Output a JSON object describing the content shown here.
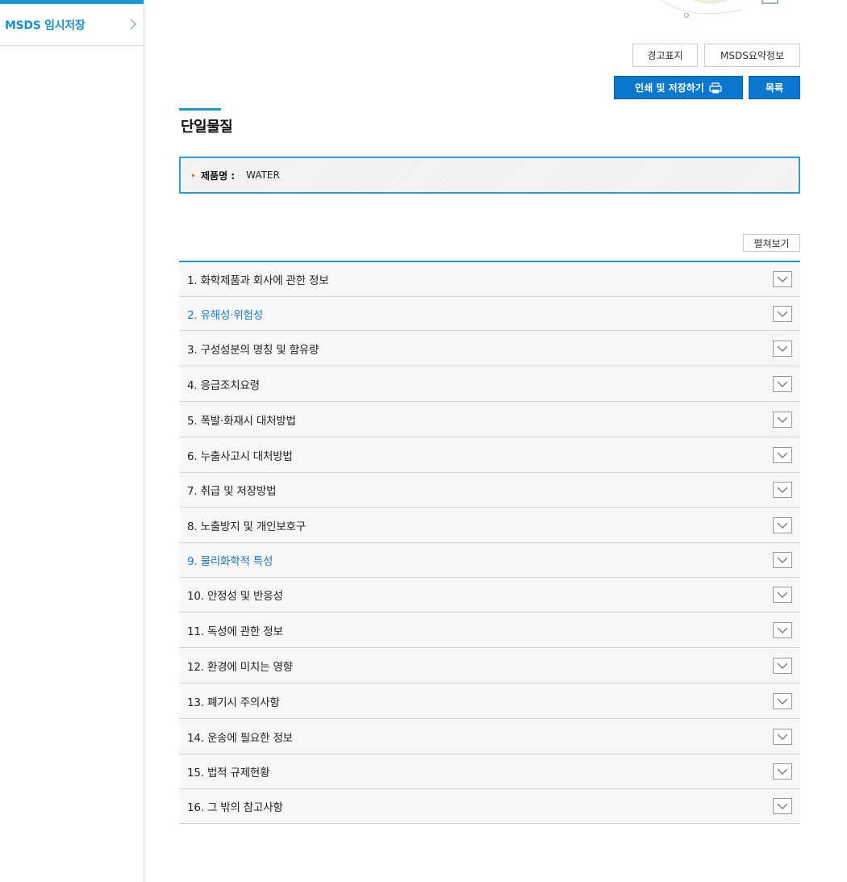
{
  "sidebar": {
    "item_label": "MSDS 임시저장"
  },
  "toolbar": {
    "warning_label": "경고표지",
    "msds_summary": "MSDS요약정보",
    "print_save": "인쇄 및 저장하기",
    "list": "목록"
  },
  "page": {
    "title": "단일물질"
  },
  "product": {
    "label": "제품명 :",
    "value": "WATER"
  },
  "expand_all": "펼쳐보기",
  "sections": [
    {
      "label": "1. 화학제품과 회사에 관한 정보",
      "highlight": false
    },
    {
      "label": "2. 유해성·위험성",
      "highlight": true
    },
    {
      "label": "3. 구성성분의 명칭 및 함유량",
      "highlight": false
    },
    {
      "label": "4. 응급조치요령",
      "highlight": false
    },
    {
      "label": "5. 폭발·화재시 대처방법",
      "highlight": false
    },
    {
      "label": "6. 누출사고시 대처방법",
      "highlight": false
    },
    {
      "label": "7. 취급 및 저장방법",
      "highlight": false
    },
    {
      "label": "8. 노출방지 및 개인보호구",
      "highlight": false
    },
    {
      "label": "9. 물리화학적 특성",
      "highlight": true
    },
    {
      "label": "10. 안정성 및 반응성",
      "highlight": false
    },
    {
      "label": "11. 독성에 관한 정보",
      "highlight": false
    },
    {
      "label": "12. 환경에 미치는 영향",
      "highlight": false
    },
    {
      "label": "13. 폐기시 주의사항",
      "highlight": false
    },
    {
      "label": "14. 운송에 필요한 정보",
      "highlight": false
    },
    {
      "label": "15. 법적 규제현황",
      "highlight": false
    },
    {
      "label": "16. 그 밖의 참고사항",
      "highlight": false
    }
  ],
  "colors": {
    "accent": "#1a9ad6",
    "button_blue": "#0a78cf",
    "link_blue": "#1a7cc4"
  }
}
